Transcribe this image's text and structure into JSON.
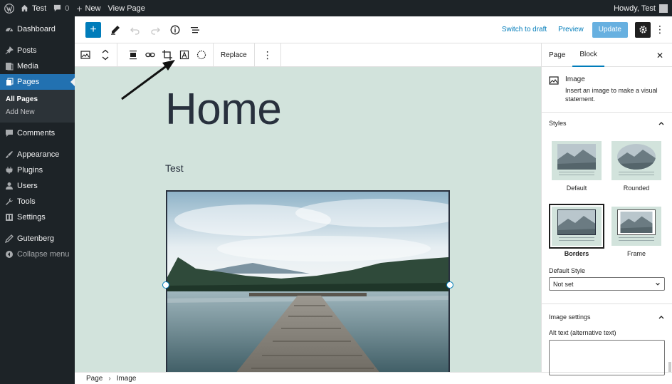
{
  "adminbar": {
    "site_name": "Test",
    "comments_count": "0",
    "new_label": "New",
    "view_page_label": "View Page",
    "howdy": "Howdy, Test"
  },
  "sidebar": {
    "items": [
      {
        "label": "Dashboard",
        "icon": "dashboard-icon"
      },
      {
        "label": "Posts",
        "icon": "pin-icon"
      },
      {
        "label": "Media",
        "icon": "media-icon"
      },
      {
        "label": "Pages",
        "icon": "pages-icon",
        "active": true
      },
      {
        "label": "Comments",
        "icon": "comment-icon"
      },
      {
        "label": "Appearance",
        "icon": "brush-icon"
      },
      {
        "label": "Plugins",
        "icon": "plugin-icon"
      },
      {
        "label": "Users",
        "icon": "user-icon"
      },
      {
        "label": "Tools",
        "icon": "wrench-icon"
      },
      {
        "label": "Settings",
        "icon": "settings-icon"
      },
      {
        "label": "Gutenberg",
        "icon": "pencil-icon"
      },
      {
        "label": "Collapse menu",
        "icon": "collapse-icon"
      }
    ],
    "submenu": [
      "All Pages",
      "Add New"
    ]
  },
  "topbar": {
    "switch_to_draft": "Switch to draft",
    "preview": "Preview",
    "update": "Update"
  },
  "blocktoolbar": {
    "replace_label": "Replace"
  },
  "canvas": {
    "title": "Home",
    "text": "Test"
  },
  "footer": {
    "crumbs": [
      "Page",
      "Image"
    ]
  },
  "panel": {
    "tab_page": "Page",
    "tab_block": "Block",
    "block_title": "Image",
    "block_desc": "Insert an image to make a visual statement.",
    "styles_heading": "Styles",
    "styles": [
      {
        "label": "Default"
      },
      {
        "label": "Rounded"
      },
      {
        "label": "Borders",
        "selected": true
      },
      {
        "label": "Frame"
      }
    ],
    "default_style_label": "Default Style",
    "default_style_value": "Not set",
    "image_settings_heading": "Image settings",
    "alt_text_label": "Alt text (alternative text)"
  },
  "colors": {
    "admin_dark": "#1d2327",
    "accent": "#007cba",
    "canvas_bg": "#d2e3dc"
  }
}
